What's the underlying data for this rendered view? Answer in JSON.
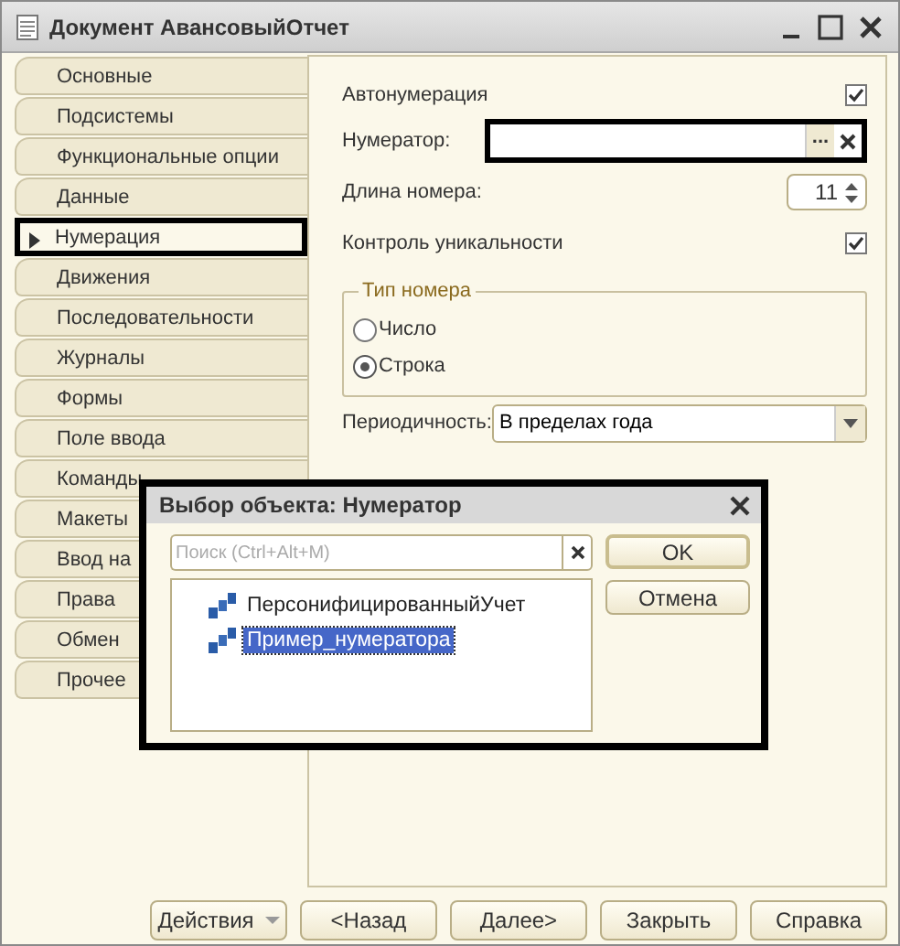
{
  "window": {
    "title": "Документ АвансовыйОтчет"
  },
  "tabs": [
    {
      "label": "Основные",
      "selected": false
    },
    {
      "label": "Подсистемы",
      "selected": false
    },
    {
      "label": "Функциональные опции",
      "selected": false
    },
    {
      "label": "Данные",
      "selected": false
    },
    {
      "label": "Нумерация",
      "selected": true
    },
    {
      "label": "Движения",
      "selected": false
    },
    {
      "label": "Последовательности",
      "selected": false
    },
    {
      "label": "Журналы",
      "selected": false
    },
    {
      "label": "Формы",
      "selected": false
    },
    {
      "label": "Поле ввода",
      "selected": false
    },
    {
      "label": "Команды",
      "selected": false
    },
    {
      "label": "Макеты",
      "selected": false
    },
    {
      "label": "Ввод на",
      "selected": false
    },
    {
      "label": "Права",
      "selected": false
    },
    {
      "label": "Обмен",
      "selected": false
    },
    {
      "label": "Прочее",
      "selected": false
    }
  ],
  "form": {
    "autonumbering": {
      "label": "Автонумерация",
      "checked": true
    },
    "numerator": {
      "label": "Нумератор:",
      "select_button": "..."
    },
    "number_length": {
      "label": "Длина номера:",
      "value": "11"
    },
    "uniqueness": {
      "label": "Контроль уникальности",
      "checked": true
    },
    "number_type": {
      "title": "Тип номера",
      "options": [
        {
          "label": "Число",
          "selected": false
        },
        {
          "label": "Строка",
          "selected": true
        }
      ]
    },
    "periodicity": {
      "label": "Периодичность:",
      "value": "В пределах года"
    }
  },
  "dialog": {
    "title": "Выбор объекта: Нумератор",
    "search": {
      "placeholder": "Поиск (Ctrl+Alt+M)"
    },
    "items": [
      {
        "label": "ПерсонифицированныйУчет",
        "selected": false
      },
      {
        "label": "Пример_нумератора",
        "selected": true
      }
    ],
    "buttons": [
      "OK",
      "Отмена"
    ]
  },
  "footer_buttons": [
    {
      "label": "Действия",
      "kind": "menu"
    },
    {
      "label": "<Назад",
      "kind": "plain"
    },
    {
      "label": "Далее>",
      "kind": "plain"
    },
    {
      "label": "Закрыть",
      "kind": "plain"
    },
    {
      "label": "Справка",
      "kind": "plain"
    }
  ]
}
